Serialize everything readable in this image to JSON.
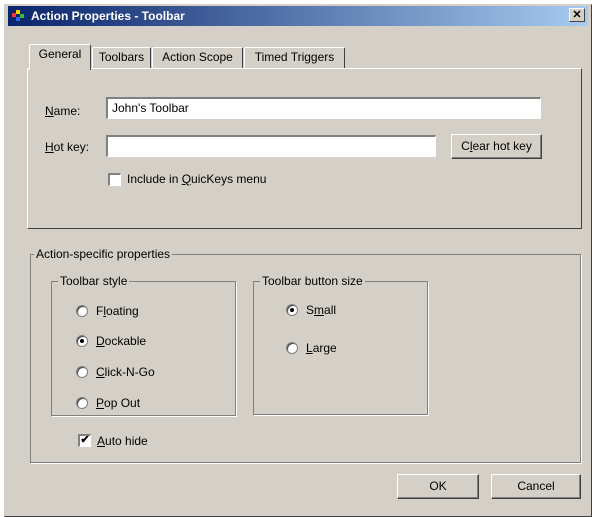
{
  "window": {
    "title": "Action Properties - Toolbar",
    "close_symbol": "✕"
  },
  "tabs": [
    {
      "label": "General",
      "active": true
    },
    {
      "label": "Toolbars",
      "active": false
    },
    {
      "label": "Action Scope",
      "active": false
    },
    {
      "label": "Timed Triggers",
      "active": false
    }
  ],
  "general": {
    "name_label_hotkey": "N",
    "name_label_rest": "ame:",
    "name_value": "John's Toolbar",
    "hotkey_label_hotkey": "H",
    "hotkey_label_rest": "ot key:",
    "hotkey_value": "",
    "clear_hotkey_pre": "C",
    "clear_hotkey_hotkey": "l",
    "clear_hotkey_rest": "ear hot key",
    "quickkeys_pre": "Include in ",
    "quickkeys_hotkey": "Q",
    "quickkeys_rest": "uicKeys menu",
    "quickkeys_checked": false
  },
  "action_props": {
    "legend": "Action-specific properties",
    "toolbar_style": {
      "legend": "Toolbar style",
      "options": [
        {
          "pre": "F",
          "hotkey": "l",
          "rest": "oating",
          "checked": false
        },
        {
          "pre": "",
          "hotkey": "D",
          "rest": "ockable",
          "checked": true
        },
        {
          "pre": "",
          "hotkey": "C",
          "rest": "lick-N-Go",
          "checked": false
        },
        {
          "pre": "",
          "hotkey": "P",
          "rest": "op Out",
          "checked": false
        }
      ]
    },
    "button_size": {
      "legend": "Toolbar button size",
      "options": [
        {
          "pre": "S",
          "hotkey": "m",
          "rest": "all",
          "checked": true
        },
        {
          "pre": "",
          "hotkey": "L",
          "rest": "arge",
          "checked": false
        }
      ]
    },
    "auto_hide": {
      "pre": "",
      "hotkey": "A",
      "rest": "uto hide",
      "checked": true
    }
  },
  "buttons": {
    "ok": "OK",
    "cancel": "Cancel"
  },
  "icons": {
    "check": "✔"
  }
}
